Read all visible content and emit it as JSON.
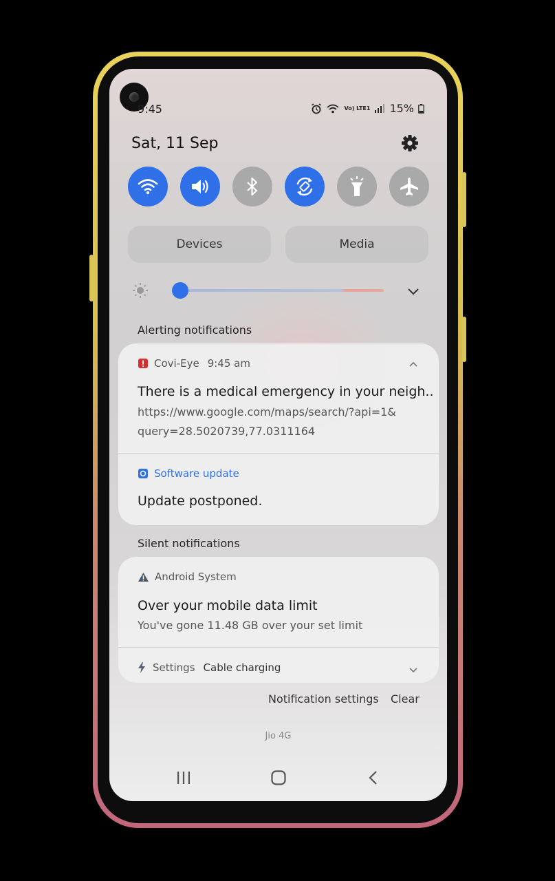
{
  "status_bar": {
    "time": "9:45",
    "battery": "15%",
    "network_label": "Vo) LTE1"
  },
  "header": {
    "date": "Sat, 11 Sep"
  },
  "quick_settings": [
    {
      "name": "wifi",
      "icon": "wifi-icon",
      "on": true
    },
    {
      "name": "sound",
      "icon": "volume-icon",
      "on": true
    },
    {
      "name": "bluetooth",
      "icon": "bluetooth-icon",
      "on": false
    },
    {
      "name": "auto-rotate",
      "icon": "rotate-icon",
      "on": true
    },
    {
      "name": "flashlight",
      "icon": "flashlight-icon",
      "on": false
    },
    {
      "name": "airplane",
      "icon": "airplane-icon",
      "on": false
    }
  ],
  "panels": {
    "devices_label": "Devices",
    "media_label": "Media"
  },
  "brightness": {
    "level": 0.04
  },
  "alerting": {
    "label": "Alerting notifications",
    "covi": {
      "app": "Covi-Eye",
      "time": "9:45 am",
      "title": "There is a medical emergency in your neigh..",
      "body_line1": "https://www.google.com/maps/search/?api=1&",
      "body_line2": "query=28.5020739,77.0311164"
    },
    "software": {
      "app": "Software update",
      "title": "Update postponed."
    }
  },
  "silent": {
    "label": "Silent notifications",
    "android": {
      "app": "Android System",
      "title": "Over your mobile data limit",
      "body": "You've gone 11.48 GB over your set limit"
    },
    "settings": {
      "app": "Settings",
      "detail": "Cable charging"
    }
  },
  "footer": {
    "notification_settings": "Notification settings",
    "clear": "Clear",
    "carrier": "Jio 4G"
  },
  "colors": {
    "accent": "#2f6fe8",
    "alert_red": "#d32f2f",
    "link_blue": "#2f6fe8"
  }
}
